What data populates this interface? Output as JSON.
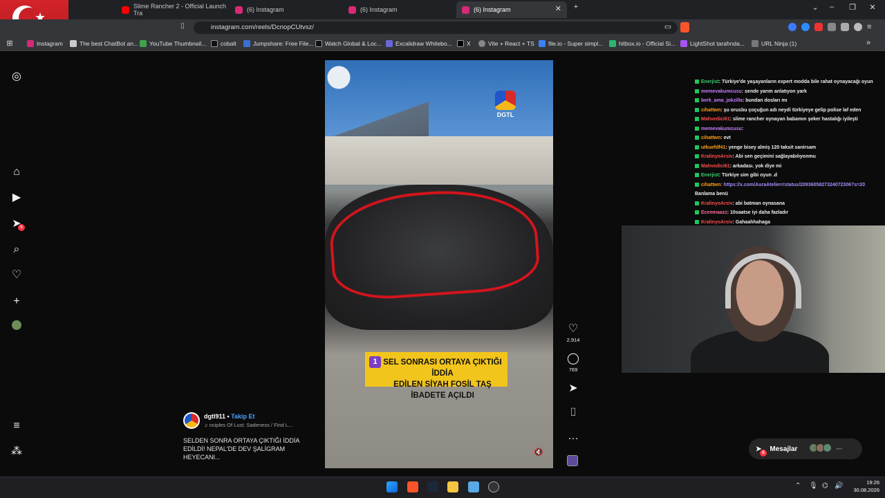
{
  "tabs": [
    {
      "label": "Slime Rancher 2 - Official Launch Tra",
      "icon": "youtube-icon",
      "color": "#ff0000"
    },
    {
      "label": "(6) Instagram",
      "icon": "instagram-icon",
      "color": "#d62976"
    },
    {
      "label": "(6) Instagram",
      "icon": "instagram-icon",
      "color": "#d62976"
    },
    {
      "label": "(6) Instagram",
      "icon": "instagram-icon",
      "color": "#d62976",
      "active": true
    }
  ],
  "address": {
    "url": "instagram.com/reels/DcnopCUtvsz/"
  },
  "bookmarks": [
    {
      "label": "Instagram",
      "icon": "instagram-icon"
    },
    {
      "label": "The best ChatBot an...",
      "icon": "chatbot-icon"
    },
    {
      "label": "YouTube Thumbnail...",
      "icon": "youtube-thumbnail-icon"
    },
    {
      "label": "cobalt",
      "icon": "cobalt-icon"
    },
    {
      "label": "Jumpshare: Free File...",
      "icon": "jumpshare-icon"
    },
    {
      "label": "Watch Global & Loc...",
      "icon": "watch-icon"
    },
    {
      "label": "Excalidraw Whitebo...",
      "icon": "excalidraw-icon"
    },
    {
      "label": "X",
      "icon": "x-icon"
    },
    {
      "label": "Vite + React + TS",
      "icon": "vite-icon"
    },
    {
      "label": "file.io - Super simpl...",
      "icon": "fileio-icon"
    },
    {
      "label": "hitbox.io - Official Si...",
      "icon": "hitbox-icon"
    },
    {
      "label": "LightShot tarafında...",
      "icon": "lightshot-icon"
    },
    {
      "label": "URL Ninja (1)",
      "icon": "urlninja-icon"
    }
  ],
  "sidebar": {
    "notifications_badge": "6"
  },
  "reel": {
    "logo_text": "DGTL",
    "caption_number": "1",
    "caption_line1": "SEL SONRASI ORTAYA ÇIKTIĞI İDDİA",
    "caption_line2": "EDİLEN SİYAH FOSİL TAŞ İBADETE AÇILDI",
    "username": "dgtl911",
    "separator": " • ",
    "follow_label": "Takip Et",
    "music": "nciples Of Lust: Sadeness / Find L...",
    "description": "SELDEN SONRA ORTAYA ÇIKTIĞI İDDİA EDİLDİ! NEPAL'DE DEV ŞALİGRAM HEYECANI...",
    "likes": "2.914",
    "comments": "769"
  },
  "chat": [
    {
      "user": "Enerjist",
      "user_color": "#3bd16f",
      "text": ": Türkiye'de yaşayanların expert modda bile rahat oynayacağı oyun"
    },
    {
      "user": "memevakumcusu",
      "user_color": "#c77dff",
      "text": ": sende yarım anlatıyon yark"
    },
    {
      "user": "berk_ama_jokzilla",
      "user_color": "#c77dff",
      "text": ": bundan dosları mı"
    },
    {
      "user": "cihattwn",
      "user_color": "#ff9f1a",
      "text": ": şu orusbu çoçuğun adı neydi türkiyeye gelip polise laf eden"
    },
    {
      "user": "Mahvedici61",
      "user_color": "#ff4d4d",
      "text": ": slime rancher oynayan babamın şeker hastalığı iyileşti"
    },
    {
      "user": "memevakumcusu",
      "user_color": "#c77dff",
      "text": ": "
    },
    {
      "user": "cihattwn",
      "user_color": "#ff9f1a",
      "text": ": evt"
    },
    {
      "user": "utkuefdf41",
      "user_color": "#ff9f1a",
      "text": ": yenge bisey almiş 120 taksit sanirsam"
    },
    {
      "user": "KralinyoArsiv",
      "user_color": "#ff4d4d",
      "text": ": Abi sen geçimini sağlayabılıyonmu"
    },
    {
      "user": "Mahvedici61",
      "user_color": "#ff4d4d",
      "text": ": arkadası. yok diye mi"
    },
    {
      "user": "Enerjist",
      "user_color": "#3bd16f",
      "text": ": Türkiye sim gibi oyun .d"
    },
    {
      "user": "cihattwn",
      "user_color": "#ff9f1a",
      "text": ": https://x.com/AuraAtelierr/status/2093605827324072306?s=20"
    },
    {
      "user": "",
      "user_color": "#ffffff",
      "text": "Banlama benü"
    },
    {
      "user": "KralinyoArsiv",
      "user_color": "#ff4d4d",
      "text": ": abi batman oynasana"
    },
    {
      "user": "Ecemnaazz",
      "user_color": "#ff6b9a",
      "text": ": 10saatse iyi daha fazladır"
    },
    {
      "user": "KralinyoArsiv",
      "user_color": "#ff4d4d",
      "text": ": Gahaahhahaga"
    }
  ],
  "messages": {
    "label": "Mesajlar",
    "badge": "6"
  },
  "taskbar": {
    "time": "19:26",
    "date": "30.08.2026"
  }
}
